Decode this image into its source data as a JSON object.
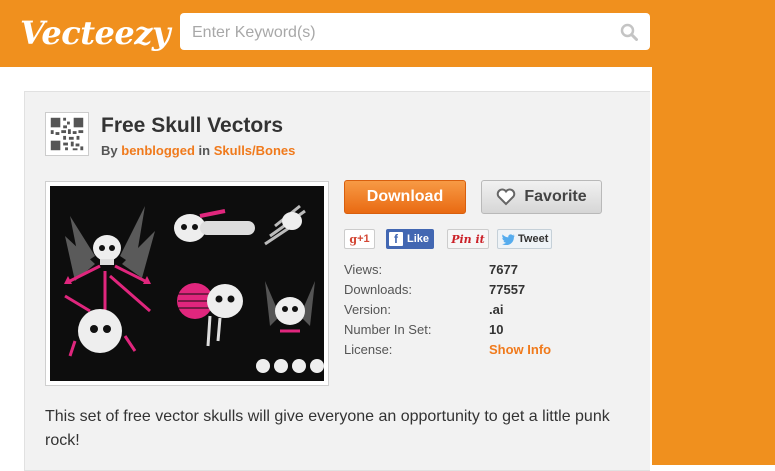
{
  "header": {
    "logo": "Vecteezy",
    "search_placeholder": "Enter Keyword(s)",
    "brand_color": "#f0901e"
  },
  "item": {
    "title": "Free Skull Vectors",
    "by_prefix": "By",
    "author": "benblogged",
    "in_word": "in",
    "category": "Skulls/Bones",
    "download_label": "Download",
    "favorite_label": "Favorite"
  },
  "social": {
    "gplus": "+1",
    "like": "Like",
    "pinit": "Pin it",
    "tweet": "Tweet"
  },
  "meta": [
    {
      "label": "Views:",
      "value": "7677"
    },
    {
      "label": "Downloads:",
      "value": "77557"
    },
    {
      "label": "Version:",
      "value": ".ai"
    },
    {
      "label": "Number In Set:",
      "value": "10"
    },
    {
      "label": "License:",
      "value": "Show Info"
    }
  ],
  "description": "This set of free vector skulls will give everyone an opportunity to get a little punk rock!"
}
